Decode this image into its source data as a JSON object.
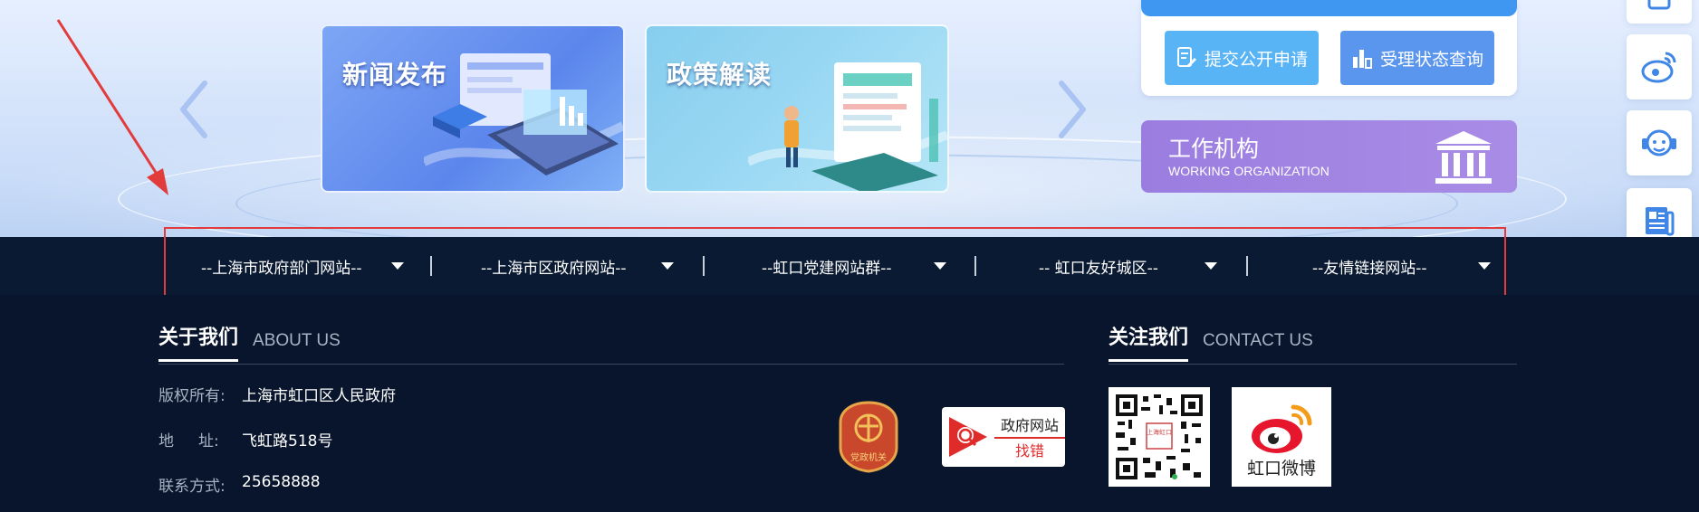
{
  "cards": {
    "news_title": "新闻发布",
    "policy_title": "政策解读"
  },
  "apply": {
    "submit_label": "提交公开申请",
    "status_label": "受理状态查询"
  },
  "org": {
    "title_cn": "工作机构",
    "title_en": "WORKING ORGANIZATION"
  },
  "links_bar": {
    "dropdowns": [
      "--上海市政府部门网站--",
      "--上海市区政府网站--",
      "--虹口党建网站群--",
      "-- 虹口友好城区--",
      "--友情链接网站--"
    ]
  },
  "footer": {
    "about": {
      "cn": "关于我们",
      "en": "ABOUT US"
    },
    "contact": {
      "cn": "关注我们",
      "en": "CONTACT US"
    },
    "info": [
      {
        "key": "版权所有:",
        "value": "上海市虹口区人民政府"
      },
      {
        "key": "地     址:",
        "value": "飞虹路518号"
      },
      {
        "key": "联系方式:",
        "value": "25658888"
      }
    ],
    "badge_text": "党政机关",
    "findbug": {
      "line1": "政府网站",
      "line2": "找错"
    },
    "qr_center_text": "上海虹口",
    "weibo_label": "虹口微博"
  },
  "colors": {
    "annotation_red": "#e23b3b",
    "footer_bg": "#08152c",
    "accent_blue": "#3f97f2",
    "org_purple": "#9b7de0"
  }
}
